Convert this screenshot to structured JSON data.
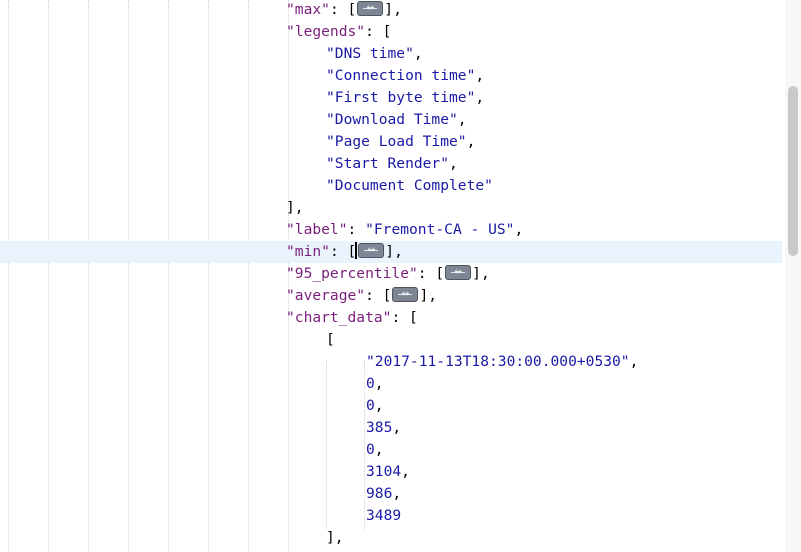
{
  "lines": [
    {
      "k": "\"max\"",
      "sep": ": [",
      "fold": true,
      "end": "],"
    },
    {
      "k": "\"legends\"",
      "sep": ": ["
    },
    {
      "s": "\"DNS time\"",
      "end": ","
    },
    {
      "s": "\"Connection time\"",
      "end": ","
    },
    {
      "s": "\"First byte time\"",
      "end": ","
    },
    {
      "s": "\"Download Time\"",
      "end": ","
    },
    {
      "s": "\"Page Load Time\"",
      "end": ","
    },
    {
      "s": "\"Start Render\"",
      "end": ","
    },
    {
      "s": "\"Document Complete\""
    },
    {
      "p": "],"
    },
    {
      "k": "\"label\"",
      "sep": ": ",
      "s": "\"Fremont-CA - US\"",
      "end": ","
    },
    {
      "k": "\"min\"",
      "sep": ": [",
      "fold": true,
      "caret": true,
      "end": "],"
    },
    {
      "k": "\"95_percentile\"",
      "sep": ": [",
      "fold": true,
      "end": "],"
    },
    {
      "k": "\"average\"",
      "sep": ": [",
      "fold": true,
      "end": "],"
    },
    {
      "k": "\"chart_data\"",
      "sep": ": ["
    },
    {
      "p": "["
    },
    {
      "s": "\"2017-11-13T18:30:00.000+0530\"",
      "end": ","
    },
    {
      "n": "0",
      "end": ","
    },
    {
      "n": "0",
      "end": ","
    },
    {
      "n": "385",
      "end": ","
    },
    {
      "n": "0",
      "end": ","
    },
    {
      "n": "3104",
      "end": ","
    },
    {
      "n": "986",
      "end": ","
    },
    {
      "n": "3489"
    },
    {
      "p": "],"
    }
  ]
}
